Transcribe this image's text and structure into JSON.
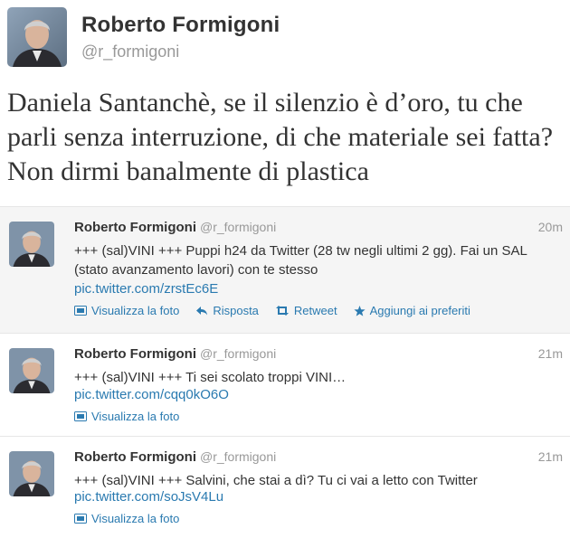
{
  "profile": {
    "name": "Roberto Formigoni",
    "handle": "@r_formigoni"
  },
  "main_tweet": {
    "text": "Daniela Santanchè, se il silenzio è d’oro, tu che parli senza interruzione, di che materiale sei fatta? Non dirmi banalmente di plastica"
  },
  "tweets": [
    {
      "name": "Roberto Formigoni",
      "handle": "@r_formigoni",
      "time": "20m",
      "text": "+++ (sal)VINI +++ Puppi h24 da Twitter (28 tw negli ultimi 2 gg). Fai un SAL (stato avanzamento lavori) con te stesso",
      "link": "pic.twitter.com/zrstEc6E",
      "actions": {
        "view_photo": "Visualizza la foto",
        "reply": "Risposta",
        "retweet": "Retweet",
        "favorite": "Aggiungi ai preferiti"
      }
    },
    {
      "name": "Roberto Formigoni",
      "handle": "@r_formigoni",
      "time": "21m",
      "text": "+++ (sal)VINI +++ Ti sei scolato troppi VINI…",
      "link": "pic.twitter.com/cqq0kO6O",
      "actions": {
        "view_photo": "Visualizza la foto"
      }
    },
    {
      "name": "Roberto Formigoni",
      "handle": "@r_formigoni",
      "time": "21m",
      "text": "+++ (sal)VINI +++ Salvini, che stai a dì? Tu ci vai a letto con Twitter",
      "link": "pic.twitter.com/soJsV4Lu",
      "actions": {
        "view_photo": "Visualizza la foto"
      }
    }
  ],
  "colors": {
    "link": "#2a7ab0",
    "muted": "#999999",
    "highlight_bg": "#f5f5f5"
  },
  "icons": [
    "photo-icon",
    "reply-icon",
    "retweet-icon",
    "star-icon"
  ]
}
